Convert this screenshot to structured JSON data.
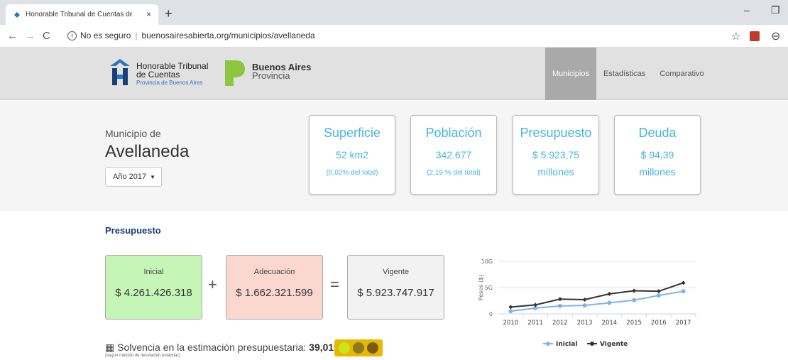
{
  "browser": {
    "tab_title": "Honorable Tribunal de Cuentas de",
    "tab_close": "×",
    "new_tab": "+",
    "url_security": "No es seguro",
    "url_host_path": "buenosairesabierta.org/municipios/avellaneda"
  },
  "header": {
    "htc_line1": "Honorable Tribunal",
    "htc_line2": "de Cuentas",
    "htc_sub": "Provincia de Buenos Aires",
    "ba_bold": "Buenos Aires",
    "ba_sub": "Provincia",
    "nav": [
      "Municipios",
      "Estadísticas",
      "Comparativo"
    ],
    "nav_active": "Municipios"
  },
  "municipio": {
    "label": "Municipio de",
    "name": "Avellaneda",
    "year_select": "Año 2017"
  },
  "stats": {
    "superficie": {
      "title": "Superficie",
      "value": "52 km2",
      "sub": "(0,02% del total)"
    },
    "poblacion": {
      "title": "Población",
      "value": "342.677",
      "sub": "(2,19 % del total)"
    },
    "presupuesto": {
      "title": "Presupuesto",
      "value": "$ 5.923,75",
      "value2": "millones"
    },
    "deuda": {
      "title": "Deuda",
      "value": "$ 94,39",
      "value2": "millones"
    }
  },
  "presupuesto": {
    "title": "Presupuesto",
    "inicial_label": "Inicial",
    "inicial_value": "$ 4.261.426.318",
    "plus": "+",
    "adecuacion_label": "Adecuación",
    "adecuacion_value": "$ 1.662.321.599",
    "equals": "=",
    "vigente_label": "Vigente",
    "vigente_value": "$ 5.923.747.917"
  },
  "solvency": {
    "text": "Solvencia en la estimación presupuestaria:",
    "value": "39,01%",
    "sub": "(segun método de desviación estándar)",
    "light_colors": [
      "#c8e61e",
      "#8a7a20",
      "#7a5a10"
    ]
  },
  "colors": {
    "accent": "#45b5e0",
    "inicial_bg": "#c6f5b8",
    "adecuacion_bg": "#fad8d0",
    "vigente_bg": "#f2f2f2",
    "nav_active": "#a9a9a9"
  },
  "chart_data": {
    "type": "line",
    "ylabel": "Pesos ($)",
    "y_ticks": [
      "0",
      "5G",
      "10G"
    ],
    "ylim": [
      0,
      10
    ],
    "x": [
      "2010",
      "2011",
      "2012",
      "2013",
      "2014",
      "2015",
      "2016",
      "2017"
    ],
    "series": [
      {
        "name": "Inicial",
        "color": "#7cb5ec",
        "values": [
          0.5,
          1.1,
          1.5,
          1.6,
          2.1,
          2.6,
          3.5,
          4.3
        ]
      },
      {
        "name": "Vigente",
        "color": "#333333",
        "values": [
          1.3,
          1.7,
          2.8,
          2.7,
          3.8,
          4.4,
          4.3,
          5.9
        ]
      }
    ],
    "legend_position": "bottom-center",
    "grid": true
  }
}
